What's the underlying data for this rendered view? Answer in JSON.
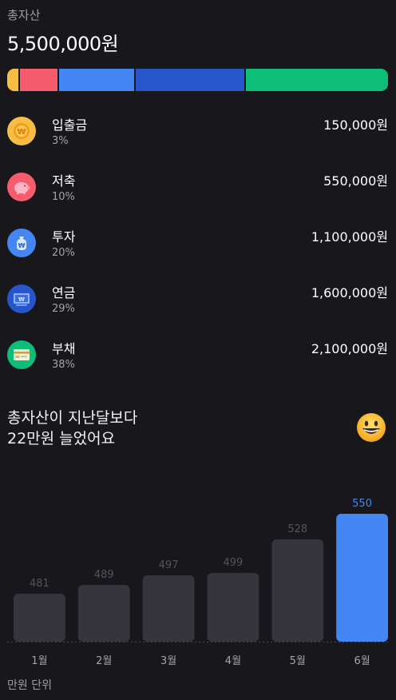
{
  "summary": {
    "total_label": "총자산",
    "total_value": "5,500,000원"
  },
  "assets": [
    {
      "name": "입출금",
      "percent": "3%",
      "amount": "150,000원",
      "share": 3,
      "color": "#f8bd43",
      "icon": "won-coin-icon"
    },
    {
      "name": "저축",
      "percent": "10%",
      "amount": "550,000원",
      "share": 10,
      "color": "#f65c6e",
      "icon": "piggy-bank-icon"
    },
    {
      "name": "투자",
      "percent": "20%",
      "amount": "1,100,000원",
      "share": 20,
      "color": "#4487f4",
      "icon": "money-bag-icon"
    },
    {
      "name": "연금",
      "percent": "29%",
      "amount": "1,600,000원",
      "share": 29,
      "color": "#2755cc",
      "icon": "banknote-icon"
    },
    {
      "name": "부채",
      "percent": "38%",
      "amount": "2,100,000원",
      "share": 38,
      "color": "#0dbe78",
      "icon": "credit-card-icon"
    }
  ],
  "trend": {
    "headline_line1": "총자산이 지난달보다",
    "headline_line2": "22만원 늘었어요",
    "emoji": "grinning-face-icon",
    "unit_label": "만원 단위"
  },
  "chart_data": {
    "type": "bar",
    "categories": [
      "1월",
      "2월",
      "3월",
      "4월",
      "5월",
      "6월"
    ],
    "values": [
      481,
      489,
      497,
      499,
      528,
      550
    ],
    "highlight_index": 5,
    "bar_color": "#36353e",
    "highlight_color": "#4487f4",
    "label_color": "#55545c",
    "highlight_label_color": "#4487f4",
    "ylim": [
      0,
      550
    ],
    "grid": false
  }
}
